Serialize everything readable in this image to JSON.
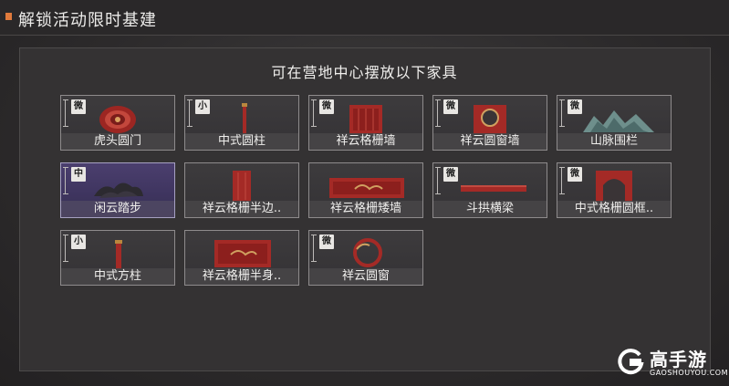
{
  "header": {
    "title": "解锁活动限时基建"
  },
  "panel": {
    "subtitle": "可在营地中心摆放以下家具"
  },
  "colors": {
    "accent": "#e07a3c",
    "card_border": "#8e8b8c",
    "highlight": "#4b3f6e",
    "item_red": "#a42a26"
  },
  "items": [
    {
      "label": "虎头圆门",
      "size": "微",
      "icon": "tiger-head-round-door-icon"
    },
    {
      "label": "中式圆柱",
      "size": "小",
      "icon": "chinese-round-pillar-icon"
    },
    {
      "label": "祥云格栅墙",
      "size": "微",
      "icon": "cloud-lattice-wall-icon"
    },
    {
      "label": "祥云圆窗墙",
      "size": "微",
      "icon": "cloud-round-window-wall-icon"
    },
    {
      "label": "山脉围栏",
      "size": "微",
      "icon": "mountain-fence-icon"
    },
    {
      "label": "闲云踏步",
      "size": "中",
      "icon": "cloud-step-icon"
    },
    {
      "label": "祥云格栅半边..",
      "size": "",
      "icon": "cloud-lattice-half-icon"
    },
    {
      "label": "祥云格栅矮墙",
      "size": "",
      "icon": "cloud-lattice-low-wall-icon"
    },
    {
      "label": "斗拱横梁",
      "size": "微",
      "icon": "bracket-beam-icon"
    },
    {
      "label": "中式格栅圆框..",
      "size": "微",
      "icon": "chinese-lattice-round-frame-icon"
    },
    {
      "label": "中式方柱",
      "size": "小",
      "icon": "chinese-square-pillar-icon"
    },
    {
      "label": "祥云格栅半身..",
      "size": "",
      "icon": "cloud-lattice-half-body-icon"
    },
    {
      "label": "祥云圆窗",
      "size": "微",
      "icon": "cloud-round-window-icon"
    }
  ],
  "watermark": {
    "name": "高手游",
    "domain": "GAOSHOUYOU.COM"
  }
}
